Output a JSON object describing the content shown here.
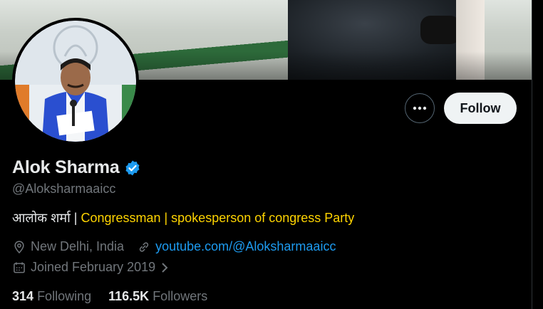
{
  "profile": {
    "display_name": "Alok Sharma",
    "handle": "@Aloksharmaaicc",
    "verified_icon": "verified-badge-icon",
    "bio_prefix": "आलोक शर्मा |",
    "bio_highlight": " Congressman | spokesperson of congress Party",
    "location": "New Delhi, India",
    "website": "youtube.com/@Aloksharmaaicc",
    "joined": "Joined February 2019",
    "following_count": "314",
    "following_label": "Following",
    "followers_count": "116.5K",
    "followers_label": "Followers"
  },
  "actions": {
    "follow_label": "Follow",
    "more_icon": "more-horizontal-icon"
  },
  "colors": {
    "background": "#000000",
    "link": "#1d9bf0",
    "highlight": "#ffd400",
    "muted": "#71767b",
    "verified": "#1d9bf0"
  }
}
